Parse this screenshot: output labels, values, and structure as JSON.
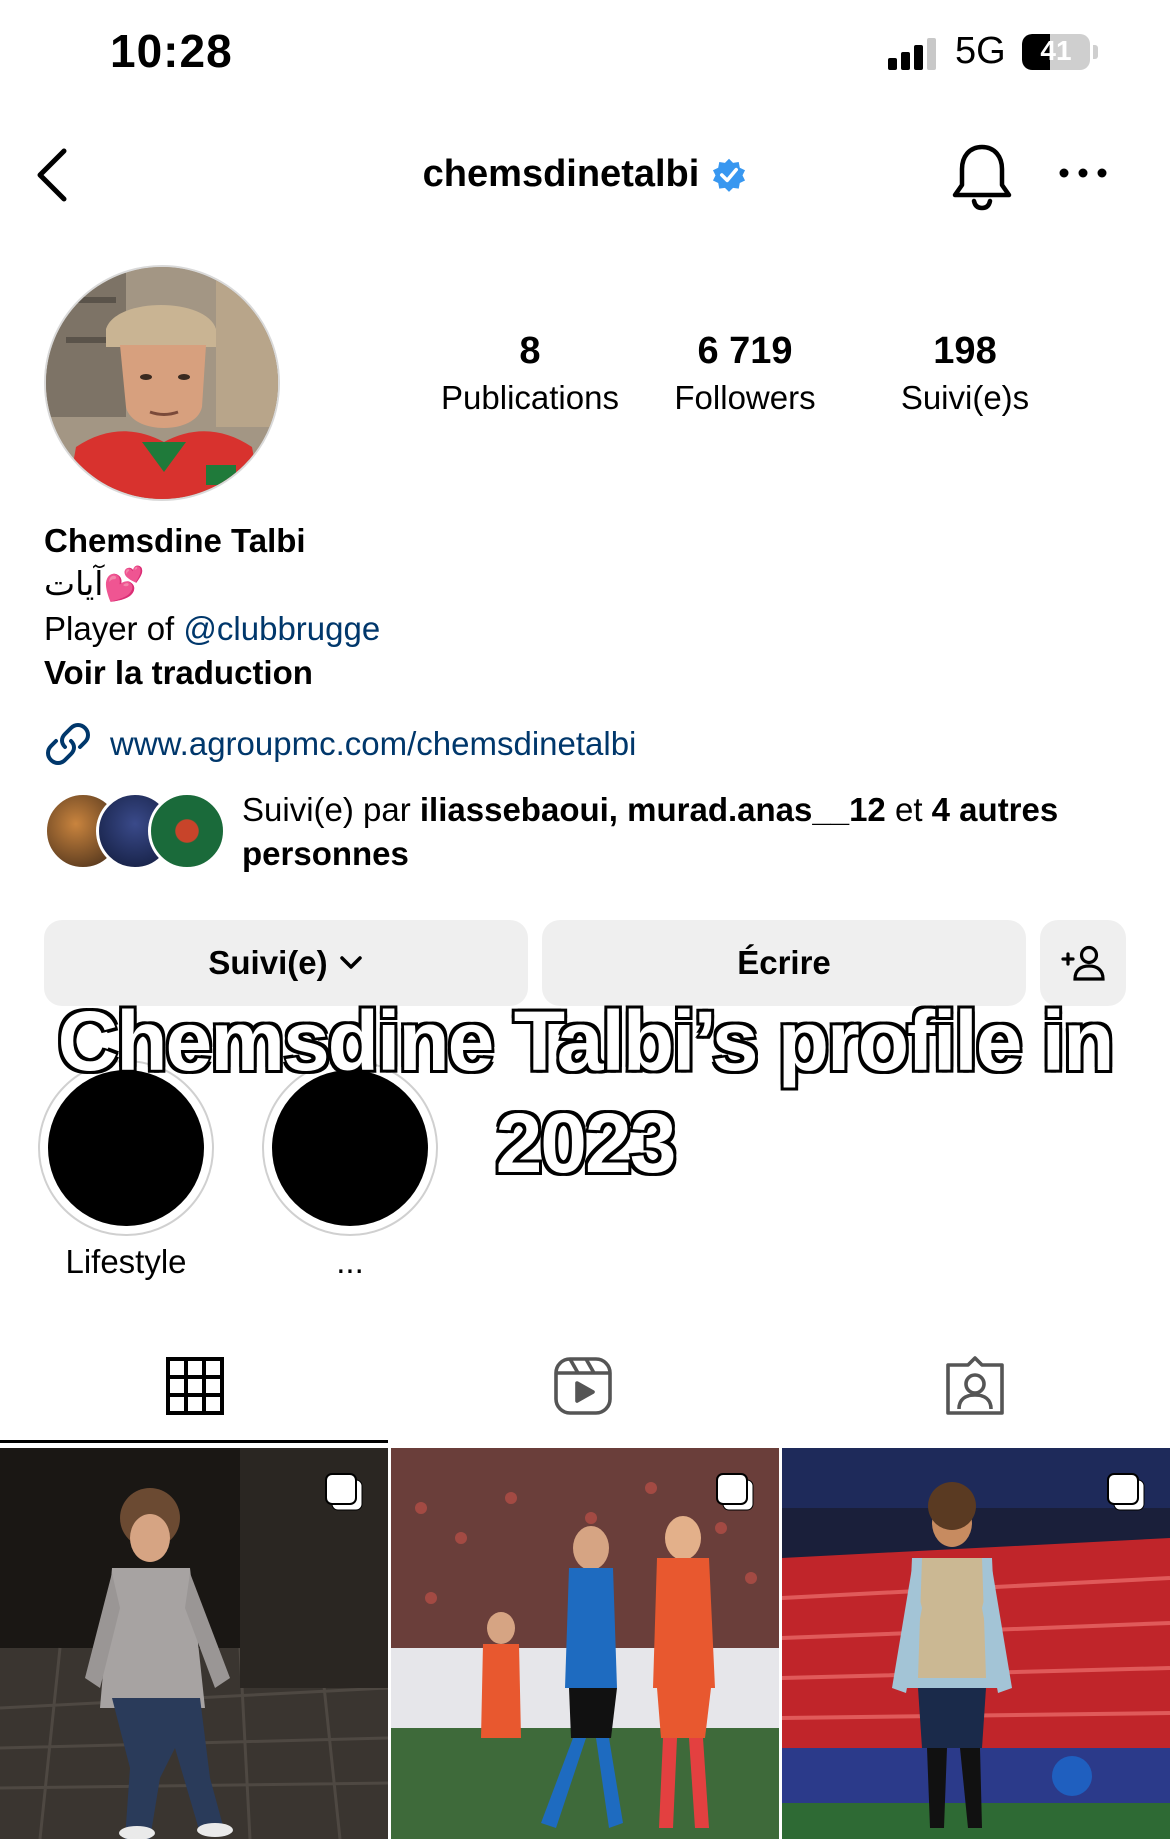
{
  "status_bar": {
    "time": "10:28",
    "network": "5G",
    "battery": "41",
    "battery_level": 0.41
  },
  "header": {
    "username": "chemsdinetalbi",
    "verified": true,
    "icons": [
      "chevron-left-icon",
      "verified-badge-icon",
      "bell-icon",
      "more-icon"
    ]
  },
  "stats": {
    "posts_count": "8",
    "posts_label": "Publications",
    "followers_count": "6 719",
    "followers_label": "Followers",
    "following_count": "198",
    "following_label": "Suivi(e)s"
  },
  "bio": {
    "name": "Chemsdine Talbi",
    "line1": "آيات💕",
    "line2_prefix": "Player of ",
    "line2_mention": "@clubbrugge",
    "translate": "Voir la traduction",
    "link": "www.agroupmc.com/chemsdinetalbi"
  },
  "followed_by": {
    "prefix": "Suivi(e) par ",
    "users": "iliassebaoui, murad.anas__12",
    "conj": " et ",
    "others": "4 autres personnes"
  },
  "actions": {
    "following_label": "Suivi(e)",
    "message_label": "Écrire",
    "add_user_icon": "add-user-icon"
  },
  "caption": {
    "line1": "Chemsdine Talbi’s profile in",
    "line2": "2023"
  },
  "highlights": [
    {
      "label": "Lifestyle"
    },
    {
      "label": "..."
    }
  ],
  "tabs": [
    "grid-icon",
    "reels-icon",
    "tagged-icon"
  ],
  "colors": {
    "link": "#00376b",
    "verified": "#3897f0",
    "button_bg": "#efefef"
  }
}
